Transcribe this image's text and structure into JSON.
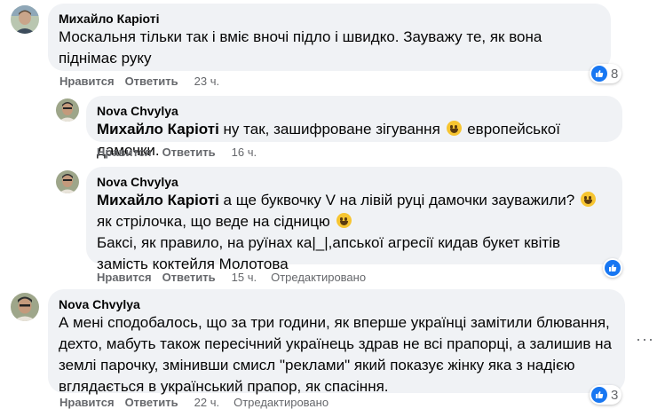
{
  "comments": [
    {
      "author": "Михайло Каріоті",
      "text": "Москальня тільки так і вміє вночі підло і швидко. Зауважу те, як вона піднімає руку",
      "reactions": "8",
      "like": "Нравится",
      "reply": "Ответить",
      "time": "23 ч."
    },
    {
      "author": "Nova Chvylya",
      "mention": "Михайло Каріоті",
      "text1": " ну так, зашифроване зігування ",
      "text2": " европейської дамочки.",
      "like": "Нравится",
      "reply": "Ответить",
      "time": "16 ч."
    },
    {
      "author": "Nova Chvylya",
      "mention": "Михайло Каріоті",
      "text1": " а ще буквочку V на лівій руці дамочки зауважили? ",
      "text2": " як стрілочка, що веде на сідницю ",
      "text3": "Баксі, як правило, на руїнах ка|_|,апської агресії кидав букет квітів замість коктейля Молотова",
      "like": "Нравится",
      "reply": "Ответить",
      "time": "15 ч.",
      "edited": "Отредактировано"
    },
    {
      "author": "Nova Chvylya",
      "text": "А мені сподобалось, що за три години, як вперше українці замітили блювання, дехто, мабуть також пересічний українець здрав не всі прапорці, а залишив на землі парочку, змінивши смисл \"реклами\" який показує жінку яка з надією вглядається в український прапор, як спасіння.",
      "reactions": "3",
      "like": "Нравится",
      "reply": "Ответить",
      "time": "22 ч.",
      "edited": "Отредактировано"
    }
  ],
  "colors": {
    "accent": "#1877f2",
    "bubble": "#f0f2f5",
    "meta": "#65676b"
  }
}
